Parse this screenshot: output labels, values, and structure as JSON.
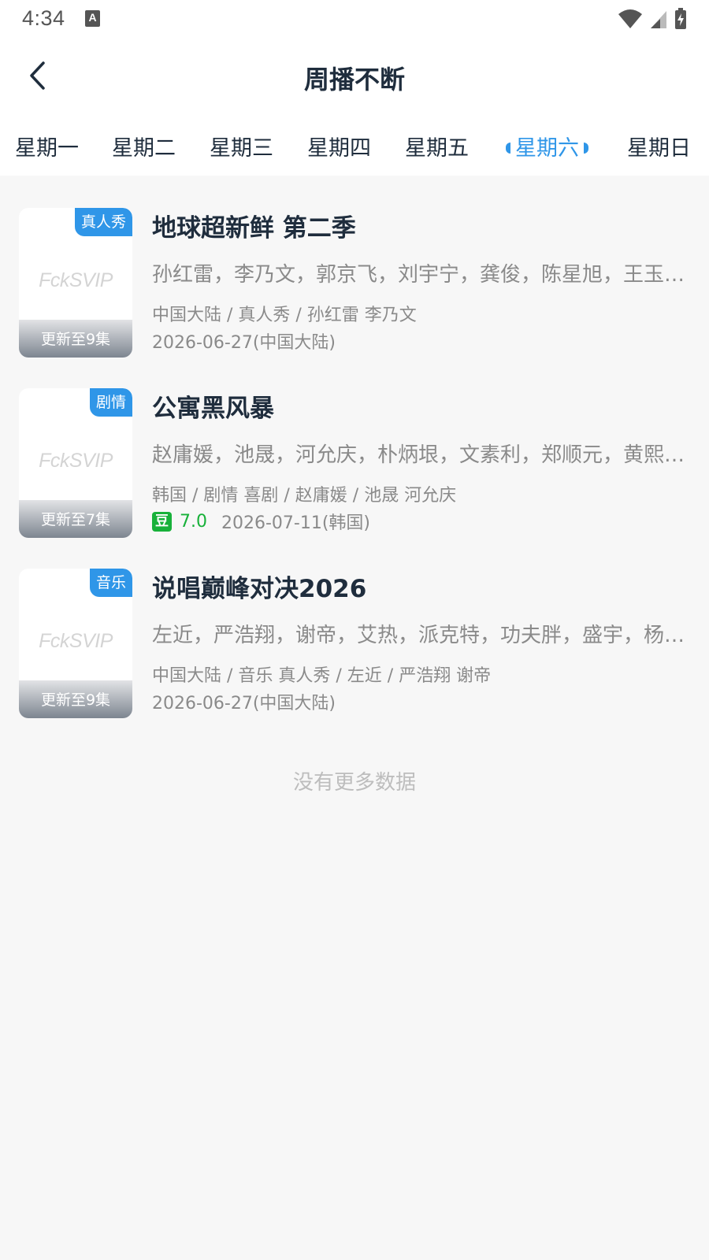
{
  "status_bar": {
    "time": "4:34",
    "keyboard_badge": "A"
  },
  "app_bar": {
    "title": "周播不断"
  },
  "day_tabs": [
    {
      "label": "星期一",
      "active": false
    },
    {
      "label": "星期二",
      "active": false
    },
    {
      "label": "星期三",
      "active": false
    },
    {
      "label": "星期四",
      "active": false
    },
    {
      "label": "星期五",
      "active": false
    },
    {
      "label": "星期六",
      "active": true
    },
    {
      "label": "星期日",
      "active": false
    }
  ],
  "shows": [
    {
      "title": "地球超新鲜 第二季",
      "genre_badge": "真人秀",
      "poster_logo": "FckSVIP",
      "update_status": "更新至9集",
      "cast": "孙红雷，李乃文，郭京飞，刘宇宁，龚俊，陈星旭，王玉…",
      "meta": "中国大陆 / 真人秀 / 孙红雷 李乃文",
      "rating": "",
      "date": "2026-06-27(中国大陆)"
    },
    {
      "title": "公寓黑风暴",
      "genre_badge": "剧情",
      "poster_logo": "FckSVIP",
      "update_status": "更新至7集",
      "cast": "赵庸媛，池晟，河允庆，朴炳垠，文素利，郑顺元，黄熙…",
      "meta": "韩国 / 剧情 喜剧 / 赵庸媛 / 池晟 河允庆",
      "rating_icon": "豆",
      "rating": "7.0",
      "date": "2026-07-11(韩国)"
    },
    {
      "title": "说唱巅峰对决2026",
      "genre_badge": "音乐",
      "poster_logo": "FckSVIP",
      "update_status": "更新至9集",
      "cast": "左近，严浩翔，谢帝，艾热，派克特，功夫胖，盛宇，杨…",
      "meta": "中国大陆 / 音乐 真人秀 / 左近 / 严浩翔 谢帝",
      "rating": "",
      "date": "2026-06-27(中国大陆)"
    }
  ],
  "footer": {
    "no_more": "没有更多数据"
  },
  "colors": {
    "accent": "#2f96e8",
    "douban_green": "#18b13a",
    "text_primary": "#1f2d3d",
    "text_secondary": "#8a8a8a"
  },
  "icons": {
    "back": "chevron-left-icon",
    "wifi": "wifi-icon",
    "signal": "signal-icon",
    "battery": "battery-charging-icon"
  }
}
